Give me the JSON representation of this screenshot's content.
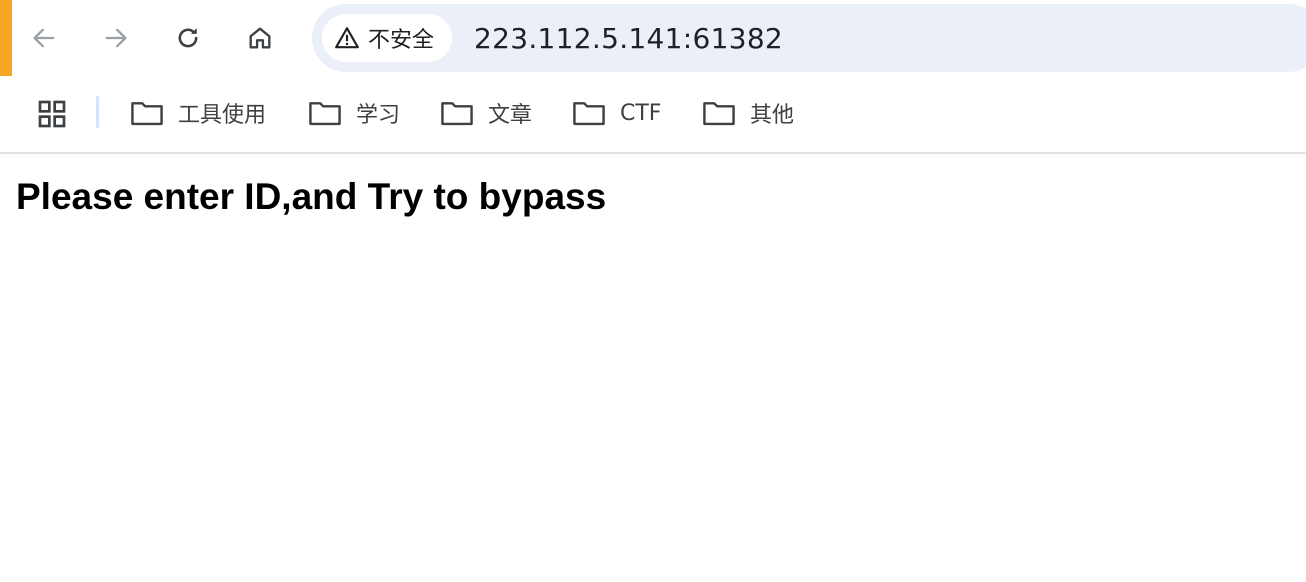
{
  "toolbar": {
    "accent_color": "#f5a623",
    "back_icon": "arrow-left-icon",
    "forward_icon": "arrow-right-icon",
    "reload_icon": "reload-icon",
    "home_icon": "home-icon"
  },
  "omnibox": {
    "security_icon": "warning-triangle-icon",
    "security_label": "不安全",
    "url": "223.112.5.141:61382",
    "background": "#ebeff7"
  },
  "bookmarks": {
    "apps_icon": "apps-grid-icon",
    "items": [
      {
        "label": "工具使用",
        "icon": "folder-icon"
      },
      {
        "label": "学习",
        "icon": "folder-icon"
      },
      {
        "label": "文章",
        "icon": "folder-icon"
      },
      {
        "label": "CTF",
        "icon": "folder-icon"
      },
      {
        "label": "其他",
        "icon": "folder-icon"
      }
    ]
  },
  "page": {
    "heading": "Please enter ID,and Try to bypass"
  }
}
